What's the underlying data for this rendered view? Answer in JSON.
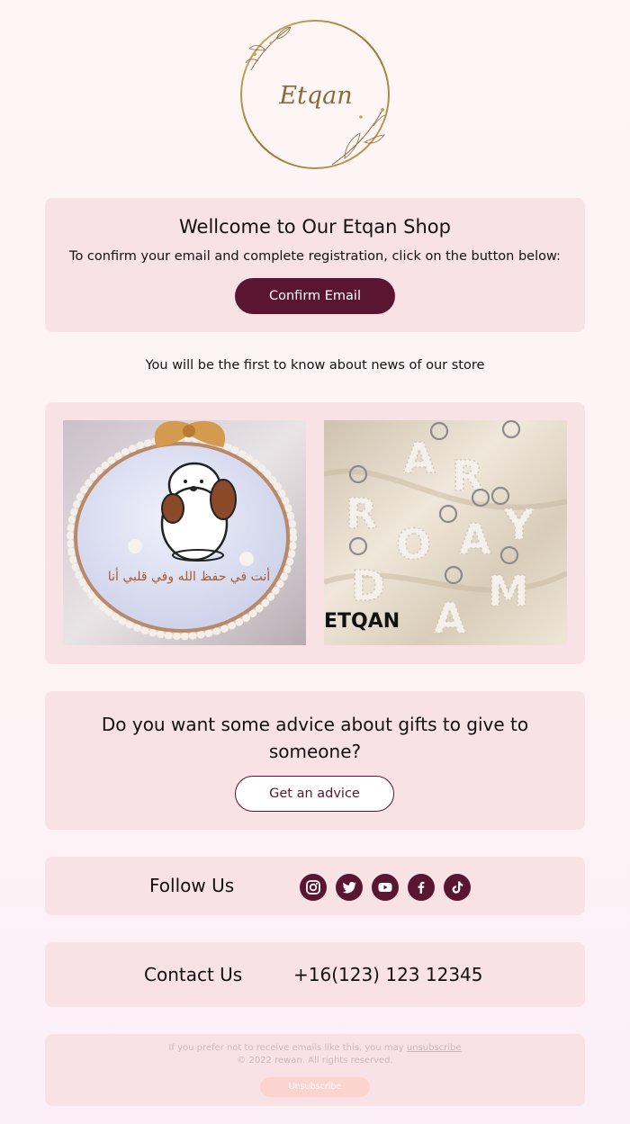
{
  "logo": {
    "text": "Etqan"
  },
  "welcome": {
    "title": "Wellcome to Our Etqan Shop",
    "subtitle": "To confirm your email and complete registration, click on the button below:",
    "button_label": "Confirm Email"
  },
  "news_text": "You will be the first to know about news of our store",
  "images": {
    "hoop_embroidery_text": "ﺃﻧﺖ ﻓﻲ ﺣﻔﻆ ﺍﻟﻠﻪ ﻭﻓﻲ ﻗﻠﺒﻲ ﺃﻧﺎ",
    "keys_watermark": "ETQAN",
    "keys_letters": [
      "A",
      "R",
      "R",
      "O",
      "A",
      "Y",
      "D",
      "A",
      "M"
    ]
  },
  "advice": {
    "question": "Do you want some advice about gifts to give to someone?",
    "button_label": "Get an advice"
  },
  "follow": {
    "label": "Follow Us",
    "icons": [
      "instagram-icon",
      "twitter-icon",
      "youtube-icon",
      "facebook-icon",
      "tiktok-icon"
    ]
  },
  "contact": {
    "label": "Contact Us",
    "phone": "+16(123) 123 12345"
  },
  "footer": {
    "notice_prefix": "If you prefer not to receive emails like this, you may ",
    "notice_link": "unsubscribe",
    "copyright": "© 2022 rewan. All rights reserved.",
    "button_label": "Unsubscribe"
  },
  "colors": {
    "accent": "#5a1530",
    "card_bg": "#f9e2e5",
    "unsubscribe_bg": "#fbd3cf",
    "logo_gold": "#b8934a"
  }
}
